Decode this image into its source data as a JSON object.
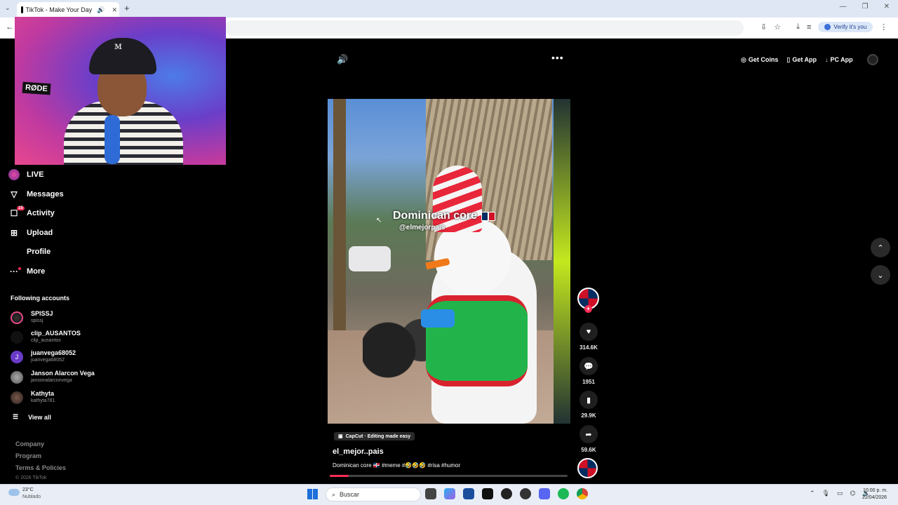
{
  "browser": {
    "tab_title": "TikTok - Make Your Day",
    "verify_label": "Verify it's you"
  },
  "webcam": {
    "mic_brand": "RØDE"
  },
  "sidebar": {
    "nav": [
      {
        "label": "LIVE",
        "icon": "live-icon"
      },
      {
        "label": "Messages",
        "icon": "messages-icon"
      },
      {
        "label": "Activity",
        "icon": "activity-icon",
        "badge": "15"
      },
      {
        "label": "Upload",
        "icon": "upload-icon"
      },
      {
        "label": "Profile",
        "icon": "profile-icon"
      },
      {
        "label": "More",
        "icon": "more-icon"
      }
    ],
    "following_header": "Following accounts",
    "accounts": [
      {
        "name": "SPISSJ",
        "handle": "spissj"
      },
      {
        "name": "clip_AUSANTOS",
        "handle": "clip_ausantos"
      },
      {
        "name": "juanvega68052",
        "handle": "juanvega68052",
        "initial": "J"
      },
      {
        "name": "Janson Alarcon Vega",
        "handle": "jansonalarconvega"
      },
      {
        "name": "Kathyta",
        "handle": "kathyta781"
      }
    ],
    "view_all": "View all",
    "footer": {
      "company": "Company",
      "program": "Program",
      "terms": "Terms & Policies",
      "copyright": "© 2026 TikTok"
    }
  },
  "topbar": {
    "get_coins": "Get Coins",
    "get_app": "Get App",
    "pc_app": "PC App"
  },
  "video": {
    "overlay_title": "Dominican core",
    "overlay_handle": "@elmejorpais",
    "capcut_label": "CapCut · Editing made easy",
    "author": "el_mejor..pais",
    "description": "Dominican core 🇩🇴 #meme #🤣🤣🤣 #risa #humor",
    "progress": 0.08
  },
  "actions": {
    "likes": "314.6K",
    "comments": "1951",
    "saves": "29.9K",
    "shares": "59.6K"
  },
  "taskbar": {
    "temperature": "23°C",
    "condition": "Nublado",
    "search_placeholder": "Buscar",
    "time": "10:00 p. m.",
    "date": "22/04/2026"
  },
  "colors": {
    "accent": "#fe2c55",
    "background": "#000000"
  }
}
